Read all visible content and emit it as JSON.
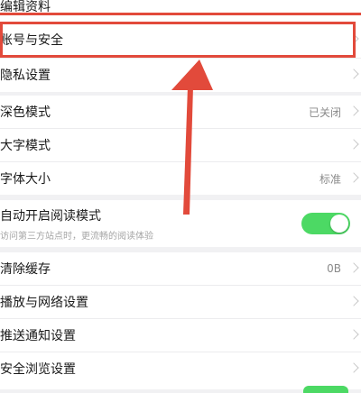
{
  "settings": {
    "edit_profile": "编辑资料",
    "account_security": "账号与安全",
    "privacy": "隐私设置",
    "dark_mode": {
      "label": "深色模式",
      "value": "已关闭"
    },
    "large_font_mode": "大字模式",
    "font_size": {
      "label": "字体大小",
      "value": "标准"
    },
    "auto_reading": {
      "label": "自动开启阅读模式",
      "sublabel": "访问第三方站点时，更流畅的阅读体验",
      "enabled": true
    },
    "clear_cache": {
      "label": "清除缓存",
      "value": "0B"
    },
    "playback_network": "播放与网络设置",
    "push_notifications": "推送通知设置",
    "safe_browsing": "安全浏览设置"
  },
  "colors": {
    "annotation_red": "#e24a3b",
    "toggle_green": "#4cd964",
    "background": "#f1f1f3"
  }
}
